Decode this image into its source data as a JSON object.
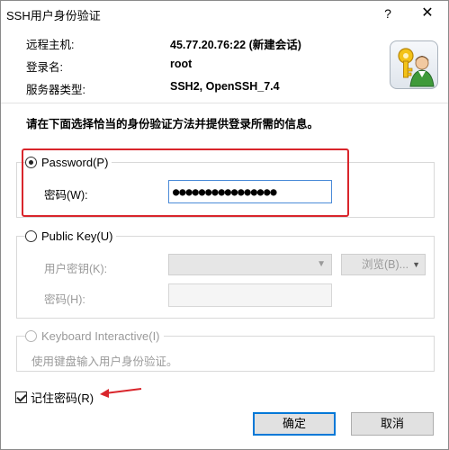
{
  "window": {
    "title": "SSH用户身份验证",
    "help_glyph": "?",
    "close_glyph": "✕"
  },
  "info": {
    "rows": [
      {
        "label": "远程主机:",
        "value": "45.77.20.76:22 (新建会话)"
      },
      {
        "label": "登录名:",
        "value": "root"
      },
      {
        "label": "服务器类型:",
        "value": "SSH2, OpenSSH_7.4"
      }
    ],
    "badge_icon": "key-user-icon"
  },
  "instruction": "请在下面选择恰当的身份验证方法并提供登录所需的信息。",
  "password_group": {
    "radio_label": "Password(P)",
    "selected": true,
    "field_label": "密码(W):",
    "field_value": "●●●●●●●●●●●●●●●●"
  },
  "publickey_group": {
    "radio_label": "Public Key(U)",
    "selected": false,
    "key_label": "用户密钥(K):",
    "browse_label": "浏览(B)...",
    "password_label": "密码(H):"
  },
  "keyboard_group": {
    "radio_label": "Keyboard Interactive(I)",
    "description": "使用键盘输入用户身份验证。"
  },
  "remember": {
    "label": "记住密码(R)",
    "checked": true
  },
  "buttons": {
    "ok": "确定",
    "cancel": "取消"
  },
  "colors": {
    "annotation": "#d9252b",
    "focus": "#0078d7"
  }
}
